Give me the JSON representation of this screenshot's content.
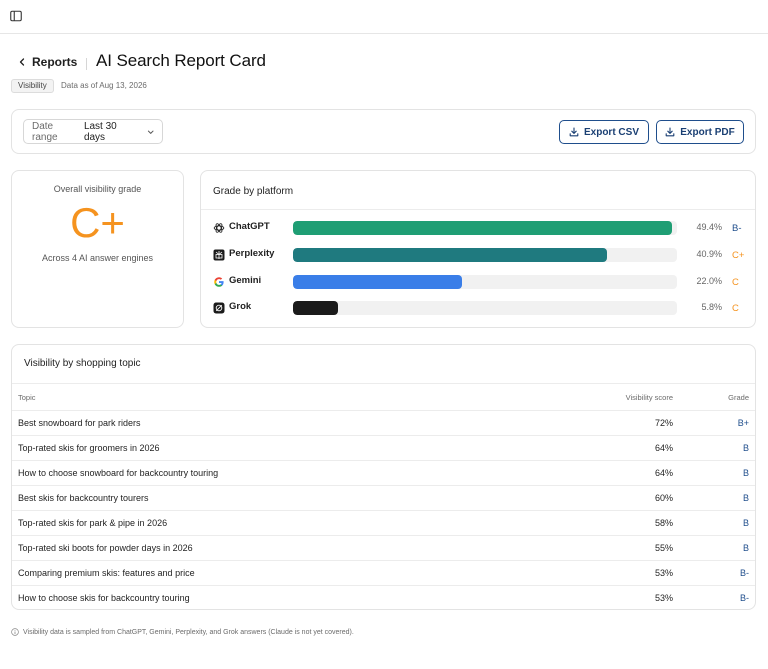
{
  "header": {
    "back_label": "Reports",
    "title": "AI Search Report Card",
    "badge": "Visibility",
    "data_as_of": "Data as of Aug 13, 2026"
  },
  "controls": {
    "date_range_label": "Date range",
    "date_range_value": "Last 30 days",
    "export_csv_label": "Export CSV",
    "export_pdf_label": "Export PDF",
    "accent_color": "#1f4e8c"
  },
  "overall": {
    "label": "Overall visibility grade",
    "grade": "C+",
    "subtitle": "Across 4 AI answer engines",
    "grade_color": "#f5931f"
  },
  "platforms": {
    "title": "Grade by platform",
    "items": [
      {
        "name": "ChatGPT",
        "icon": "chatgpt-icon",
        "value": 49.4,
        "pct_label": "49.4%",
        "grade": "B-",
        "grade_color": "#1f4e8c",
        "bar_color": "#1f9e74"
      },
      {
        "name": "Perplexity",
        "icon": "perplexity-icon",
        "value": 40.9,
        "pct_label": "40.9%",
        "grade": "C+",
        "grade_color": "#f5931f",
        "bar_color": "#1f7a7f"
      },
      {
        "name": "Gemini",
        "icon": "google-icon",
        "value": 22.0,
        "pct_label": "22.0%",
        "grade": "C",
        "grade_color": "#f5931f",
        "bar_color": "#3a7ee8"
      },
      {
        "name": "Grok",
        "icon": "grok-icon",
        "value": 5.8,
        "pct_label": "5.8%",
        "grade": "C",
        "grade_color": "#f5931f",
        "bar_color": "#1b1b1b"
      }
    ]
  },
  "topics": {
    "title": "Visibility by shopping topic",
    "columns": {
      "topic": "Topic",
      "score": "Visibility score",
      "grade": "Grade"
    },
    "rows": [
      {
        "topic": "Best snowboard for park riders",
        "score": "72%",
        "grade": "B+"
      },
      {
        "topic": "Top-rated skis for groomers in 2026",
        "score": "64%",
        "grade": "B"
      },
      {
        "topic": "How to choose snowboard for backcountry touring",
        "score": "64%",
        "grade": "B"
      },
      {
        "topic": "Best skis for backcountry tourers",
        "score": "60%",
        "grade": "B"
      },
      {
        "topic": "Top-rated skis for park & pipe in 2026",
        "score": "58%",
        "grade": "B"
      },
      {
        "topic": "Top-rated ski boots for powder days in 2026",
        "score": "55%",
        "grade": "B"
      },
      {
        "topic": "Comparing premium skis: features and price",
        "score": "53%",
        "grade": "B-"
      },
      {
        "topic": "How to choose skis for backcountry touring",
        "score": "53%",
        "grade": "B-"
      }
    ]
  },
  "footnote": "Visibility data is sampled from ChatGPT, Gemini, Perplexity, and Grok answers (Claude is not yet covered)."
}
